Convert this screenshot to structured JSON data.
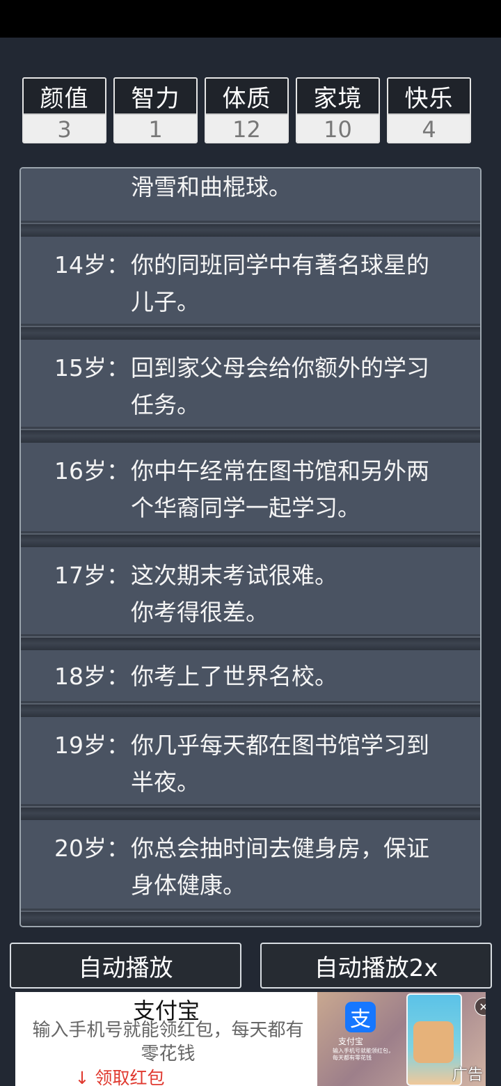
{
  "stats": [
    {
      "name": "颜值",
      "value": "3"
    },
    {
      "name": "智力",
      "value": "1"
    },
    {
      "name": "体质",
      "value": "12"
    },
    {
      "name": "家境",
      "value": "10"
    },
    {
      "name": "快乐",
      "value": "4"
    }
  ],
  "log": {
    "entries": [
      {
        "age": "",
        "text": "滑雪和曲棍球。"
      },
      {
        "age": "14岁：",
        "text": "你的同班同学中有著名球星的\n儿子。"
      },
      {
        "age": "15岁：",
        "text": "回到家父母会给你额外的学习\n任务。"
      },
      {
        "age": "16岁：",
        "text": "你中午经常在图书馆和另外两\n个华裔同学一起学习。"
      },
      {
        "age": "17岁：",
        "text": "这次期末考试很难。\n你考得很差。"
      },
      {
        "age": "18岁：",
        "text": "你考上了世界名校。"
      },
      {
        "age": "19岁：",
        "text": "你几乎每天都在图书馆学习到\n半夜。"
      },
      {
        "age": "20岁：",
        "text": "你总会抽时间去健身房，保证\n身体健康。"
      }
    ]
  },
  "buttons": {
    "autoplay": "自动播放",
    "autoplay2x": "自动播放2x"
  },
  "ad": {
    "title": "支付宝",
    "desc": "输入手机号就能领红包，每天都有零花钱",
    "cta": "↓ 领取红包",
    "brand_glyph": "支",
    "brand_name": "支付宝",
    "mini_text": "输入手机号就能领红包，每天都有零花钱",
    "label": "广告",
    "close": "✕"
  }
}
